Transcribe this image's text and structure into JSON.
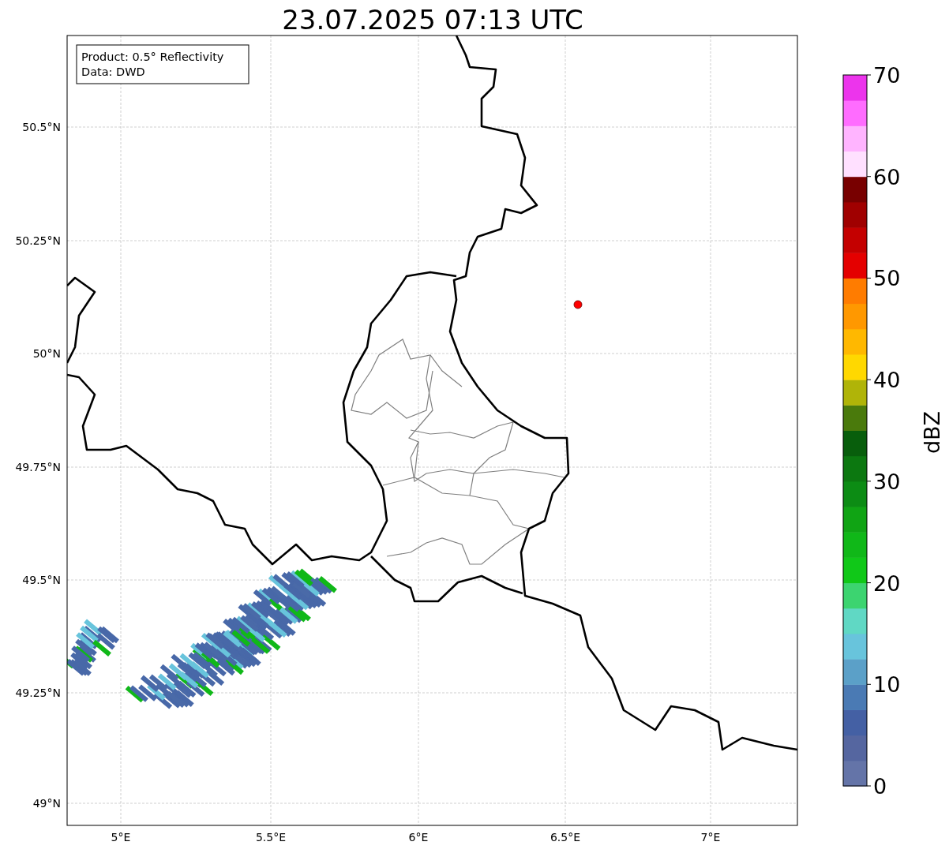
{
  "title": "23.07.2025 07:13 UTC",
  "info_box": {
    "lines": [
      "Product: 0.5° Reflectivity",
      "Data: DWD"
    ]
  },
  "lat_ticks": [
    "50.5°N",
    "50.25°N",
    "50°N",
    "49.75°N",
    "49.5°N",
    "49.25°N",
    "49°N"
  ],
  "lon_ticks": [
    "5°E",
    "5.5°E",
    "6°E",
    "6.5°E",
    "7°E"
  ],
  "colorbar": {
    "label": "dBZ",
    "ticks": [
      "70",
      "60",
      "50",
      "40",
      "30",
      "20",
      "10",
      "0"
    ],
    "levels": [
      {
        "color": "#6474a8"
      },
      {
        "color": "#5566a0"
      },
      {
        "color": "#4460a4"
      },
      {
        "color": "#4a7ab4"
      },
      {
        "color": "#5ba0c8"
      },
      {
        "color": "#68c4dc"
      },
      {
        "color": "#60d8c4"
      },
      {
        "color": "#3cd470"
      },
      {
        "color": "#10c818"
      },
      {
        "color": "#10b818"
      },
      {
        "color": "#10a414"
      },
      {
        "color": "#0c8c14"
      },
      {
        "color": "#0c7810"
      },
      {
        "color": "#085e0c"
      },
      {
        "color": "#4a7a0c"
      },
      {
        "color": "#b0b408"
      },
      {
        "color": "#ffd800"
      },
      {
        "color": "#ffb800"
      },
      {
        "color": "#ff9800"
      },
      {
        "color": "#ff7c00"
      },
      {
        "color": "#e40000"
      },
      {
        "color": "#c40000"
      },
      {
        "color": "#a00000"
      },
      {
        "color": "#780000"
      },
      {
        "color": "#ffe0ff"
      },
      {
        "color": "#ffb4ff"
      },
      {
        "color": "#ff6cff"
      },
      {
        "color": "#ec34ec"
      }
    ]
  }
}
